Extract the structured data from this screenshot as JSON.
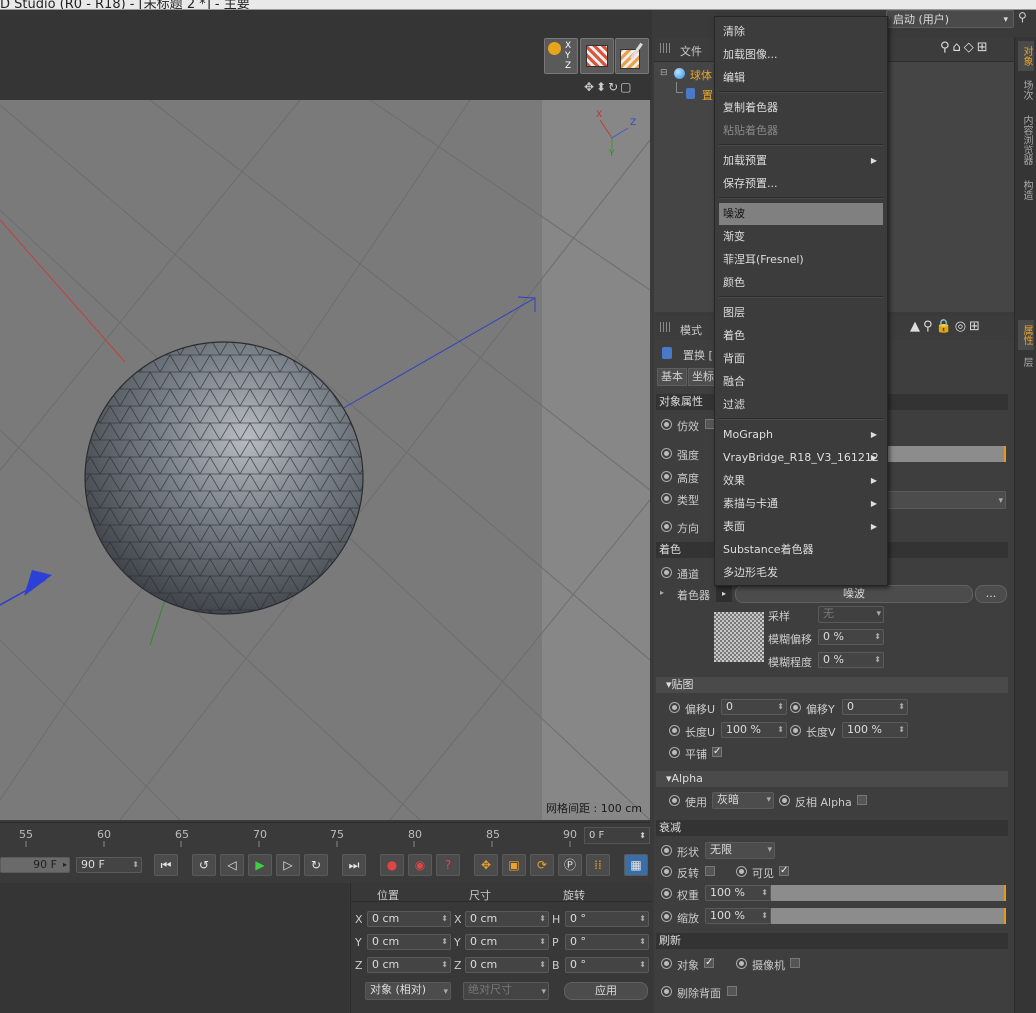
{
  "window": {
    "title": "D Studio (R0 - R18) - [未标题 2 *] - 主要"
  },
  "layout": {
    "label": "启动 (用户)"
  },
  "object_manager": {
    "menu_file": "文件",
    "objects": [
      "球体",
      "置"
    ]
  },
  "viewport": {
    "grid_info": "网格间距 : 100 cm",
    "axis_x": "X",
    "axis_y": "Y",
    "axis_z": "Z"
  },
  "timeline": {
    "ticks": [
      "55",
      "60",
      "65",
      "70",
      "75",
      "80",
      "85",
      "90"
    ],
    "current_frame": "0 F",
    "end_frame_a": "90 F",
    "end_frame_b": "90 F"
  },
  "coords": {
    "headers": [
      "位置",
      "尺寸",
      "旋转"
    ],
    "rows": [
      {
        "p_label": "X",
        "p_val": "0 cm",
        "s_label": "X",
        "s_val": "0 cm",
        "r_label": "H",
        "r_val": "0 °"
      },
      {
        "p_label": "Y",
        "p_val": "0 cm",
        "s_label": "Y",
        "s_val": "0 cm",
        "r_label": "P",
        "r_val": "0 °"
      },
      {
        "p_label": "Z",
        "p_val": "0 cm",
        "s_label": "Z",
        "s_val": "0 cm",
        "r_label": "B",
        "r_val": "0 °"
      }
    ],
    "mode_select": "对象 (相对)",
    "size_select": "绝对尺寸",
    "apply": "应用"
  },
  "attributes": {
    "mode_menu": "模式",
    "object_name": "置换 [",
    "tabs": [
      "基本",
      "坐标"
    ],
    "sec_object": "对象属性",
    "imitate": "仿效",
    "strength": "强度",
    "height": "高度",
    "type": "类型",
    "direction": "方向",
    "sec_shading": "着色",
    "channel": "通道",
    "shader_label": "着色器",
    "shader_value": "噪波",
    "shader_more": "...",
    "sampling_label": "采样",
    "sampling_value": "无",
    "blur_offset_label": "模糊偏移",
    "blur_offset_value": "0 %",
    "blur_scale_label": "模糊程度",
    "blur_scale_value": "0 %",
    "sec_mapping": "贴图",
    "offset_u_label": "偏移U",
    "offset_u": "0",
    "offset_v_label": "偏移Y",
    "offset_v": "0",
    "length_u_label": "长度U",
    "length_u": "100 %",
    "length_v_label": "长度V",
    "length_v": "100 %",
    "tile_label": "平铺",
    "sec_alpha": "Alpha",
    "use_label": "使用",
    "use_value": "灰暗",
    "invert_alpha": "反相 Alpha",
    "sec_falloff": "衰减",
    "shape_label": "形状",
    "shape_value": "无限",
    "invert_label": "反转",
    "visible_label": "可见",
    "weight_label": "权重",
    "weight_value": "100 %",
    "scale_label": "缩放",
    "scale_value": "100 %",
    "sec_refresh": "刷新",
    "obj_label": "对象",
    "camera_label": "摄像机",
    "backface_label": "剔除背面"
  },
  "side_tabs_top": [
    "对象",
    "场次",
    "内容浏览器",
    "构造"
  ],
  "side_tabs_bottom": [
    "属性",
    "层"
  ],
  "context_menu": {
    "items": [
      {
        "label": "清除"
      },
      {
        "label": "加载图像..."
      },
      {
        "label": "编辑"
      },
      {
        "label": "复制着色器"
      },
      {
        "label": "粘贴着色器"
      },
      {
        "label": "加载预置"
      },
      {
        "label": "保存预置..."
      },
      {
        "label": "噪波"
      },
      {
        "label": "渐变"
      },
      {
        "label": "菲涅耳(Fresnel)"
      },
      {
        "label": "颜色"
      },
      {
        "label": "图层"
      },
      {
        "label": "着色"
      },
      {
        "label": "背面"
      },
      {
        "label": "融合"
      },
      {
        "label": "过滤"
      },
      {
        "label": "MoGraph"
      },
      {
        "label": "VrayBridge_R18_V3_161212"
      },
      {
        "label": "效果"
      },
      {
        "label": "素描与卡通"
      },
      {
        "label": "表面"
      },
      {
        "label": "Substance着色器"
      },
      {
        "label": "多边形毛发"
      }
    ]
  }
}
